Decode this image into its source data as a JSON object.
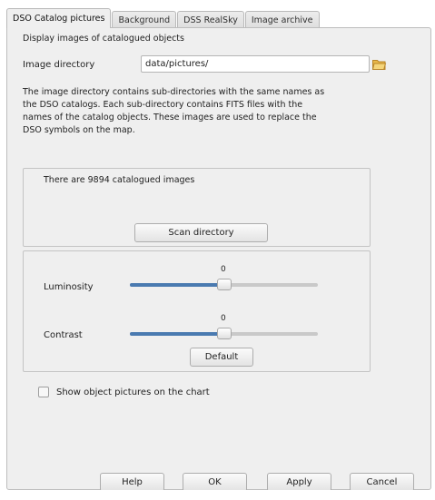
{
  "tabs": [
    {
      "label": "DSO Catalog pictures",
      "active": true
    },
    {
      "label": "Background",
      "active": false
    },
    {
      "label": "DSS RealSky",
      "active": false
    },
    {
      "label": "Image archive",
      "active": false
    }
  ],
  "panel": {
    "heading": "Display images of catalogued objects",
    "image_directory_label": "Image directory",
    "image_directory_value": "data/pictures/",
    "description_lines": [
      "The image directory contains sub-directories with the same names as",
      "the DSO catalogs. Each sub-directory contains FITS files with the",
      "names of the catalog objects. These images are used to replace the",
      "DSO symbols on the map."
    ]
  },
  "catalog_box": {
    "count_text": "There are 9894 catalogued images",
    "scan_button": "Scan directory"
  },
  "adjust_box": {
    "luminosity": {
      "label": "Luminosity",
      "value_text": "0",
      "fraction": 0.5
    },
    "contrast": {
      "label": "Contrast",
      "value_text": "0",
      "fraction": 0.5
    },
    "default_button": "Default"
  },
  "show_pictures": {
    "label": "Show object pictures on the chart",
    "checked": false
  },
  "buttons": {
    "help": "Help",
    "ok": "OK",
    "apply": "Apply",
    "cancel": "Cancel"
  },
  "colors": {
    "slider_fill": "#4a7ab0",
    "folder_icon": "#e9b84a"
  }
}
